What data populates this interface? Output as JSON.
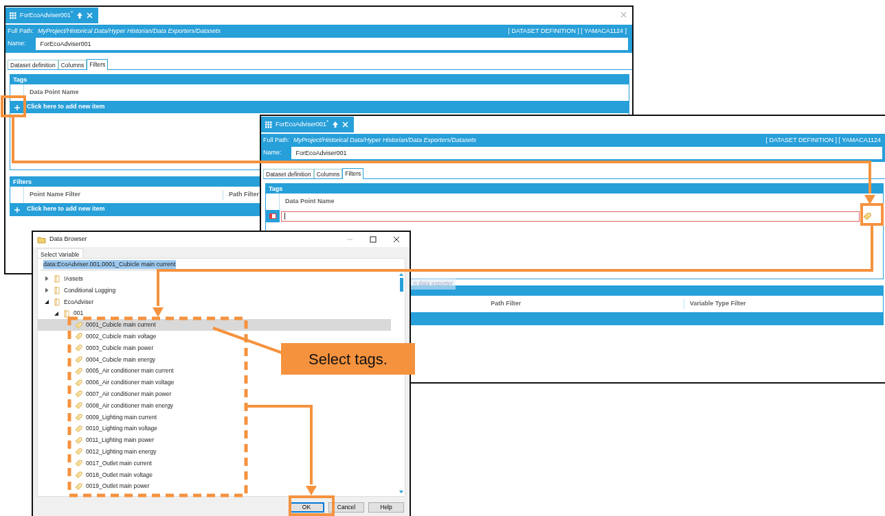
{
  "window_back": {
    "tab_title": "ForEcoAdviser001",
    "modified_mark": "*",
    "full_path_label": "Full Path:",
    "full_path": "MyProject/Historical Data/Hyper Historian/Data Exporters/Datasets",
    "right_info": "[ DATASET DEFINITION ] [ YAMACA1124 ]",
    "name_label": "Name:",
    "name_value": "ForEcoAdviser001",
    "tabs": [
      {
        "label": "Dataset definition",
        "selected": false
      },
      {
        "label": "Columns",
        "selected": false
      },
      {
        "label": "Filters",
        "selected": true
      }
    ],
    "tags": {
      "title": "Tags",
      "column": "Data Point Name",
      "row": {
        "kind": "add",
        "text": "Click here to add new item"
      }
    },
    "filters": {
      "title": "Filters",
      "columns": [
        "Point Name Filter",
        "Path Filter"
      ],
      "add_row": "Click here to add new item"
    }
  },
  "window_front": {
    "tab_title": "ForEcoAdviser001",
    "modified_mark": "*",
    "full_path_label": "Full Path:",
    "full_path": "MyProject/Historical Data/Hyper Historian/Data Exporters/Datasets",
    "right_info": "[ DATASET DEFINITION ] [ YAMACA1124",
    "name_label": "Name:",
    "name_value": "ForEcoAdviser001",
    "tabs": [
      {
        "label": "Dataset definition",
        "selected": false
      },
      {
        "label": "Columns",
        "selected": false
      },
      {
        "label": "Filters",
        "selected": true
      }
    ],
    "tags": {
      "title": "Tags",
      "column": "Data Point Name",
      "row": {
        "kind": "edit"
      }
    },
    "tooltip": "n data exporter",
    "filters": {
      "columns": [
        "Path Filter",
        "Variable Type Filter"
      ]
    }
  },
  "browser": {
    "title": "Data Browser",
    "tab": "Select Variable",
    "path_value": "data:EcoAdviser.001.0001_Cubicle main current",
    "path_selected": true,
    "tree": [
      {
        "kind": "folder",
        "label": "!Assets",
        "expanded": false
      },
      {
        "kind": "folder",
        "label": "Conditional Logging",
        "expanded": false
      },
      {
        "kind": "folder",
        "label": "EcoAdviser",
        "expanded": true,
        "children": [
          {
            "kind": "folder",
            "label": "001",
            "expanded": true,
            "children": [
              {
                "kind": "tag",
                "label": "0001_Cubicle main current",
                "selected": true
              },
              {
                "kind": "tag",
                "label": "0002_Cubicle main voltage",
                "selected": false
              },
              {
                "kind": "tag",
                "label": "0003_Cubicle main power",
                "selected": false
              },
              {
                "kind": "tag",
                "label": "0004_Cubicle main energy",
                "selected": false
              },
              {
                "kind": "tag",
                "label": "0005_Air conditioner main current",
                "selected": false
              },
              {
                "kind": "tag",
                "label": "0006_Air conditioner main voltage",
                "selected": false
              },
              {
                "kind": "tag",
                "label": "0007_Air conditioner main power",
                "selected": false
              },
              {
                "kind": "tag",
                "label": "0008_Air conditioner main energy",
                "selected": false
              },
              {
                "kind": "tag",
                "label": "0009_Lighting main current",
                "selected": false
              },
              {
                "kind": "tag",
                "label": "0010_Lighting main voltage",
                "selected": false
              },
              {
                "kind": "tag",
                "label": "0011_Lighting main power",
                "selected": false
              },
              {
                "kind": "tag",
                "label": "0012_Lighting main energy",
                "selected": false
              },
              {
                "kind": "tag",
                "label": "0017_Outlet main current",
                "selected": false
              },
              {
                "kind": "tag",
                "label": "0018_Outlet main voltage",
                "selected": false
              },
              {
                "kind": "tag",
                "label": "0019_Outlet main power",
                "selected": false
              }
            ]
          }
        ]
      }
    ],
    "buttons": [
      {
        "label": "OK",
        "focused": true
      },
      {
        "label": "Cancel",
        "focused": false
      },
      {
        "label": "Help",
        "focused": false
      }
    ]
  },
  "callout": "Select tags."
}
